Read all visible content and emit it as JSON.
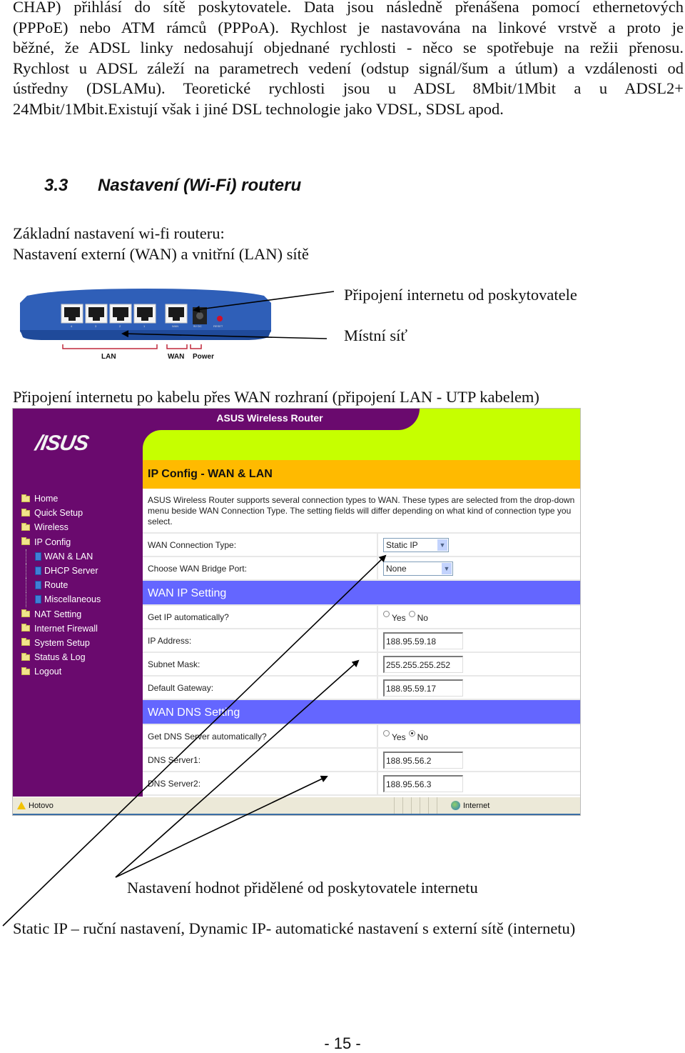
{
  "intro_paragraph": {
    "lines": [
      "CHAP) přihlásí do sítě poskytovatele. Data jsou následně přenášena pomocí ethernetových",
      "(PPPoE) nebo ATM rámců (PPPoA). Rychlost je nastavována na linkové vrstvě a proto je",
      "běžné, že ADSL linky nedosahují objednané rychlosti - něco se spotřebuje na režii přenosu.",
      "Rychlost u ADSL záleží na parametrech vedení (odstup signál/šum a útlum) a vzdálenosti od",
      "ústředny (DSLAMu). Teoretické rychlosti jsou u ADSL 8Mbit/1Mbit a u ADSL2+",
      "24Mbit/1Mbit.Existují však i jiné DSL technologie jako VDSL, SDSL apod."
    ]
  },
  "section": {
    "number": "3.3",
    "title": "Nastavení (Wi-Fi) routeru"
  },
  "subtitle_1": "Základní nastavení wi-fi routeru:",
  "subtitle_2": "Nastavení externí (WAN) a vnitřní (LAN) sítě",
  "router_figure": {
    "lan_port_numbers": [
      "4",
      "3",
      "2",
      "1"
    ],
    "wan_port_label": "WAN",
    "power_label": "9V DC",
    "reset_label": "RESET",
    "bracket_labels": {
      "lan": "LAN",
      "wan": "WAN",
      "power": "Power"
    },
    "callout_internet": "Připojení internetu od poskytovatele",
    "callout_local": "Místní síť",
    "colors": {
      "body": "#2f5fb8",
      "bracket": "#c0283c",
      "led": "#d0102a"
    }
  },
  "caption_connection": "Připojení internetu po kabelu přes WAN rozhraní (připojení LAN - UTP kabelem)",
  "asus_ui": {
    "brand": "/ISUS",
    "window_title": "ASUS Wireless Router",
    "page_title": "IP Config - WAN & LAN",
    "colors": {
      "sidebar": "#6a0a6e",
      "topbar": "#c6ff00",
      "pagehead": "#ffba00",
      "section": "#6466ff"
    },
    "menu": [
      {
        "label": "Home",
        "type": "folder"
      },
      {
        "label": "Quick Setup",
        "type": "folder"
      },
      {
        "label": "Wireless",
        "type": "folder"
      },
      {
        "label": "IP Config",
        "type": "folder-open"
      },
      {
        "label": "WAN & LAN",
        "type": "page"
      },
      {
        "label": "DHCP Server",
        "type": "page"
      },
      {
        "label": "Route",
        "type": "page"
      },
      {
        "label": "Miscellaneous",
        "type": "page"
      },
      {
        "label": "NAT Setting",
        "type": "folder"
      },
      {
        "label": "Internet Firewall",
        "type": "folder"
      },
      {
        "label": "System Setup",
        "type": "folder"
      },
      {
        "label": "Status & Log",
        "type": "folder"
      },
      {
        "label": "Logout",
        "type": "folder"
      }
    ],
    "intro_text": "ASUS Wireless Router supports several connection types to WAN. These types are selected from the drop-down menu beside WAN Connection Type. The setting fields will differ depending on what kind of connection type you select.",
    "wan_connection_type": {
      "label": "WAN Connection Type:",
      "value": "Static IP"
    },
    "wan_bridge_port": {
      "label": "Choose WAN Bridge Port:",
      "value": "None"
    },
    "wan_ip_section": "WAN IP Setting",
    "get_ip_auto": {
      "label": "Get IP automatically?",
      "yes": "Yes",
      "no": "No",
      "selected": "none"
    },
    "ip_address": {
      "label": "IP Address:",
      "value": "188.95.59.18"
    },
    "subnet_mask": {
      "label": "Subnet Mask:",
      "value": "255.255.255.252"
    },
    "default_gateway": {
      "label": "Default Gateway:",
      "value": "188.95.59.17"
    },
    "wan_dns_section": "WAN DNS Setting",
    "get_dns_auto": {
      "label": "Get DNS Server automatically?",
      "yes": "Yes",
      "no": "No",
      "selected": "No"
    },
    "dns1": {
      "label": "DNS Server1:",
      "value": "188.95.56.2"
    },
    "dns2": {
      "label": "DNS Server2:",
      "value": "188.95.56.3"
    },
    "status_left": "Hotovo",
    "status_zone": "Internet"
  },
  "caption_values": "Nastavení hodnot přidělené od poskytovatele internetu",
  "caption_static": "Static IP – ruční nastavení, Dynamic IP- automatické nastavení s externí sítě (internetu)",
  "page_number": "- 15 -"
}
